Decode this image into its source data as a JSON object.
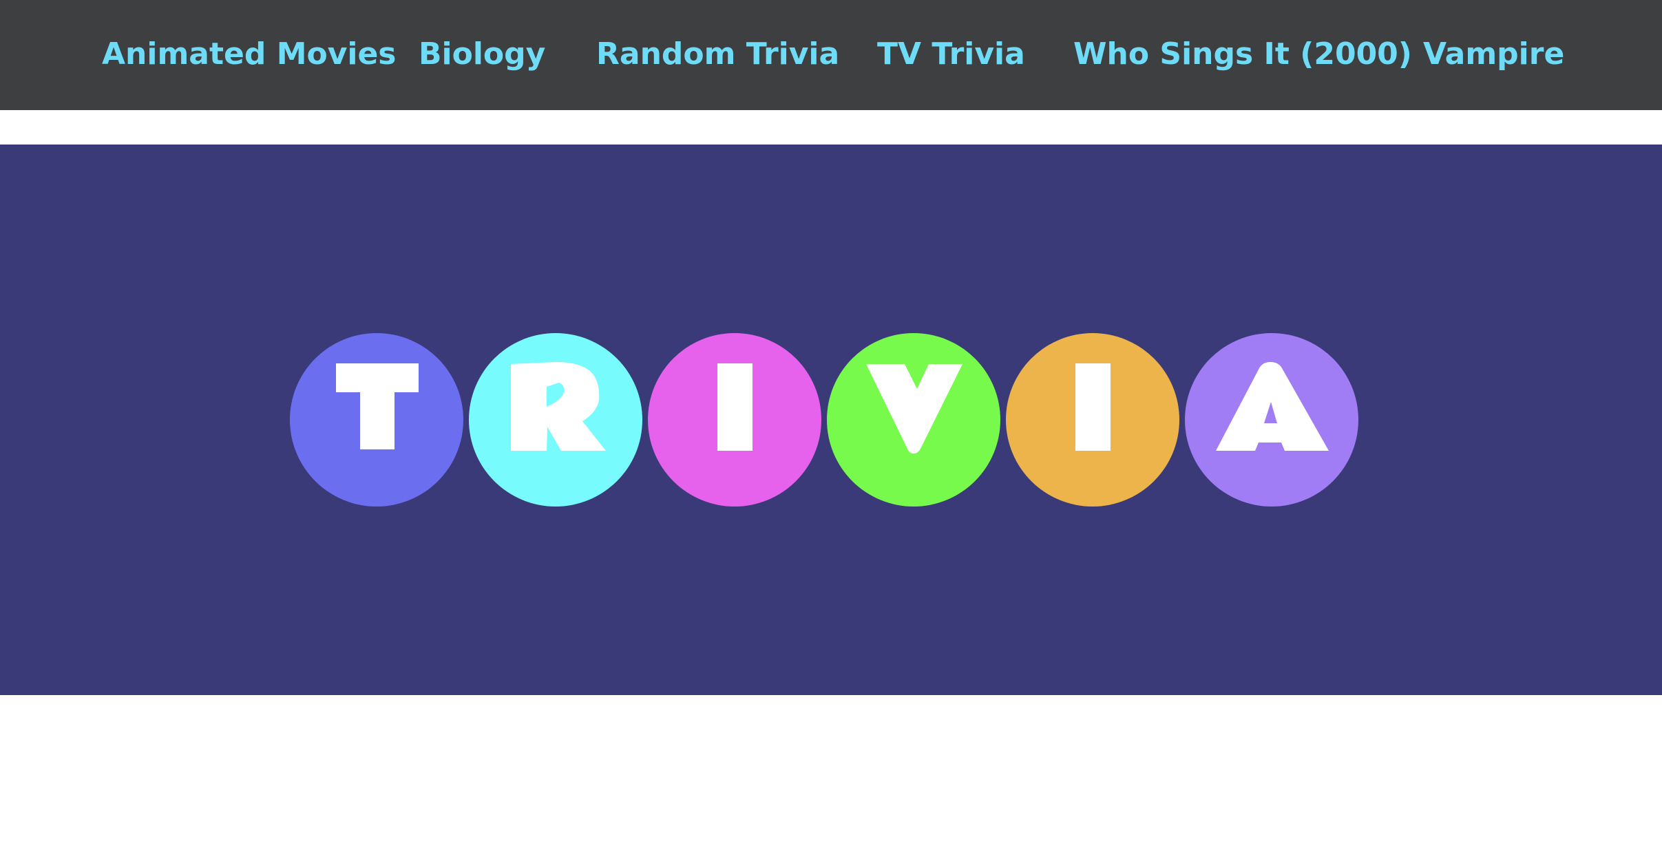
{
  "nav": {
    "items": [
      {
        "label": "Animated Movies"
      },
      {
        "label": "Biology"
      },
      {
        "label": "Random Trivia"
      },
      {
        "label": "TV Trivia"
      },
      {
        "label": "Who Sings It (2000)"
      },
      {
        "label": "Vampire"
      }
    ]
  },
  "logo": {
    "letters": [
      "T",
      "R",
      "I",
      "V",
      "I",
      "A"
    ],
    "circle_colors": [
      "#6b6eee",
      "#77fbfc",
      "#e762ec",
      "#77fa4c",
      "#ecb44a",
      "#a07cf5"
    ],
    "letter_color": "#ffffff"
  },
  "colors": {
    "nav_background": "#3e3f41",
    "nav_link": "#6fdcf7",
    "hero_background": "#3a3a78",
    "page_background": "#ffffff"
  }
}
